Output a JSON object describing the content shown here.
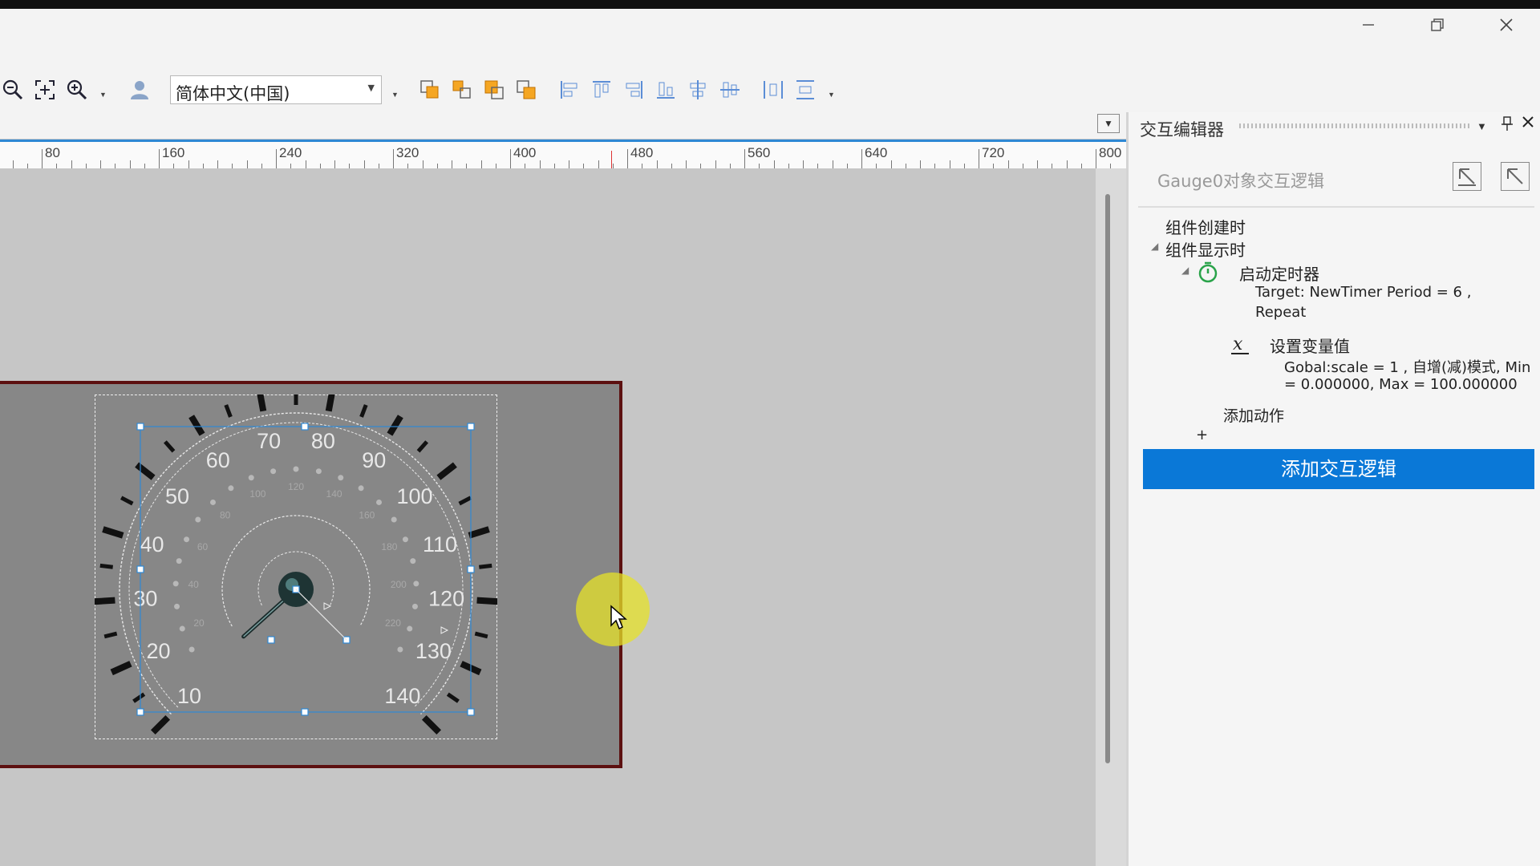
{
  "window": {
    "minimize_icon": "minimize-icon",
    "restore_icon": "restore-icon",
    "close_icon": "close-icon"
  },
  "toolbar": {
    "language_select": {
      "value": "简体中文(中国)"
    },
    "icons": [
      "zoom-out-icon",
      "zoom-fit-icon",
      "zoom-in-icon",
      "user-icon",
      "bring-front-icon",
      "send-back-icon",
      "bring-forward-icon",
      "send-backward-icon",
      "align-left-icon",
      "align-top-icon",
      "align-right-icon",
      "align-bottom-icon",
      "align-center-icon",
      "align-middle-icon",
      "distribute-h-icon",
      "distribute-v-icon"
    ]
  },
  "ruler": {
    "labels": [
      "80",
      "160",
      "240",
      "320",
      "400",
      "480",
      "560",
      "640",
      "720",
      "800"
    ]
  },
  "gauge": {
    "outer_labels": [
      "10",
      "20",
      "30",
      "40",
      "50",
      "60",
      "70",
      "80",
      "90",
      "100",
      "110",
      "120",
      "130",
      "140"
    ],
    "inner_labels": [
      "20",
      "40",
      "60",
      "80",
      "100",
      "120",
      "140",
      "160",
      "180",
      "200",
      "220"
    ],
    "colors": {
      "device_bg": "#878787",
      "device_border": "#5c1010",
      "ticks": "#111111",
      "labels": "#e8e8e8",
      "selection": "#2e88d4"
    }
  },
  "panel": {
    "title": "交互编辑器",
    "subtitle": "Gauge0对象交互逻辑",
    "tree": {
      "on_create": "组件创建时",
      "on_show": "组件显示时",
      "action1": {
        "title": "启动定时器",
        "line1": "Target: NewTimer    Period = 6   ,",
        "line2": "Repeat"
      },
      "action2": {
        "title": "设置变量值",
        "line1": "Gobal:scale = 1 , 自增(减)模式, Min",
        "line2": "= 0.000000, Max = 100.000000"
      },
      "add_action": "添加动作",
      "plus": "+"
    },
    "add_logic_button": "添加交互逻辑",
    "accent_color": "#0a78d7"
  }
}
